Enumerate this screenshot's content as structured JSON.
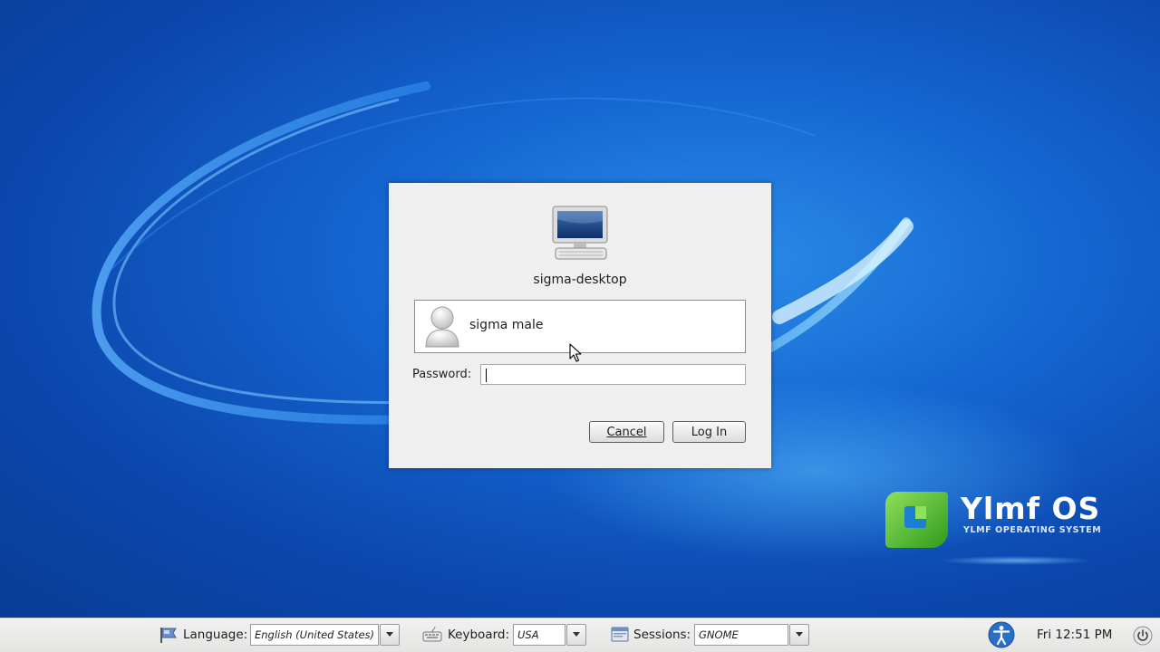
{
  "desktop": {
    "brand": {
      "title": "Ylmf OS",
      "subtitle": "YLMF OPERATING SYSTEM",
      "logo_icon": "ylmf-logo-icon"
    }
  },
  "login": {
    "hostname": "sigma-desktop",
    "host_icon": "computer-icon",
    "users": [
      {
        "name": "sigma male",
        "avatar_icon": "user-avatar-icon"
      }
    ],
    "password_label": "Password:",
    "password_value": "",
    "cancel_label": "Cancel",
    "login_label": "Log In"
  },
  "panel": {
    "language": {
      "label": "Language:",
      "value": "English (United States)",
      "icon": "language-flag-icon"
    },
    "keyboard": {
      "label": "Keyboard:",
      "value": "USA",
      "icon": "keyboard-icon"
    },
    "sessions": {
      "label": "Sessions:",
      "value": "GNOME",
      "icon": "sessions-icon"
    },
    "accessibility_icon": "accessibility-icon",
    "clock": "Fri 12:51 PM",
    "power_icon": "power-icon"
  },
  "colors": {
    "desktop_blue": "#1565d0",
    "dialog_bg": "#efefef",
    "panel_bg": "#ebebe9",
    "brand_green": "#4cb82a",
    "accessibility_blue": "#2a6fc6"
  }
}
